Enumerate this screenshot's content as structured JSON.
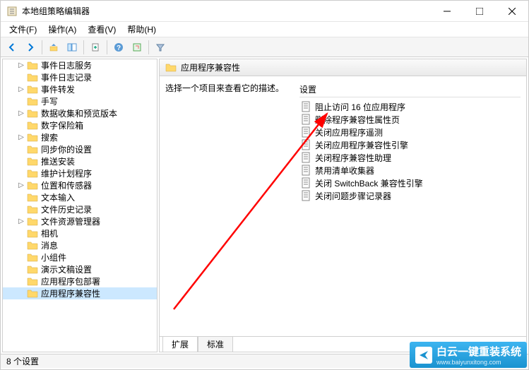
{
  "window": {
    "title": "本地组策略编辑器"
  },
  "menu": {
    "file": "文件(F)",
    "action": "操作(A)",
    "view": "查看(V)",
    "help": "帮助(H)"
  },
  "tree": {
    "items": [
      {
        "label": "事件日志服务",
        "expandable": true
      },
      {
        "label": "事件日志记录",
        "expandable": false
      },
      {
        "label": "事件转发",
        "expandable": true
      },
      {
        "label": "手写",
        "expandable": false
      },
      {
        "label": "数据收集和预览版本",
        "expandable": true
      },
      {
        "label": "数字保险箱",
        "expandable": false
      },
      {
        "label": "搜索",
        "expandable": true
      },
      {
        "label": "同步你的设置",
        "expandable": false
      },
      {
        "label": "推送安装",
        "expandable": false
      },
      {
        "label": "维护计划程序",
        "expandable": false
      },
      {
        "label": "位置和传感器",
        "expandable": true
      },
      {
        "label": "文本输入",
        "expandable": false
      },
      {
        "label": "文件历史记录",
        "expandable": false
      },
      {
        "label": "文件资源管理器",
        "expandable": true
      },
      {
        "label": "相机",
        "expandable": false
      },
      {
        "label": "消息",
        "expandable": false
      },
      {
        "label": "小组件",
        "expandable": false
      },
      {
        "label": "演示文稿设置",
        "expandable": false
      },
      {
        "label": "应用程序包部署",
        "expandable": false
      },
      {
        "label": "应用程序兼容性",
        "expandable": false,
        "selected": true
      }
    ]
  },
  "list": {
    "header_title": "应用程序兼容性",
    "description": "选择一个项目来查看它的描述。",
    "column_header": "设置",
    "items": [
      {
        "label": "阻止访问 16 位应用程序"
      },
      {
        "label": "删除程序兼容性属性页"
      },
      {
        "label": "关闭应用程序遥测"
      },
      {
        "label": "关闭应用程序兼容性引擎"
      },
      {
        "label": "关闭程序兼容性助理"
      },
      {
        "label": "禁用清单收集器"
      },
      {
        "label": "关闭 SwitchBack 兼容性引擎"
      },
      {
        "label": "关闭问题步骤记录器"
      }
    ]
  },
  "tabs": {
    "extended": "扩展",
    "standard": "标准"
  },
  "statusbar": {
    "text": "8 个设置"
  },
  "watermark": {
    "main": "白云一键重装系统",
    "sub": "www.baiyunxitong.com"
  }
}
